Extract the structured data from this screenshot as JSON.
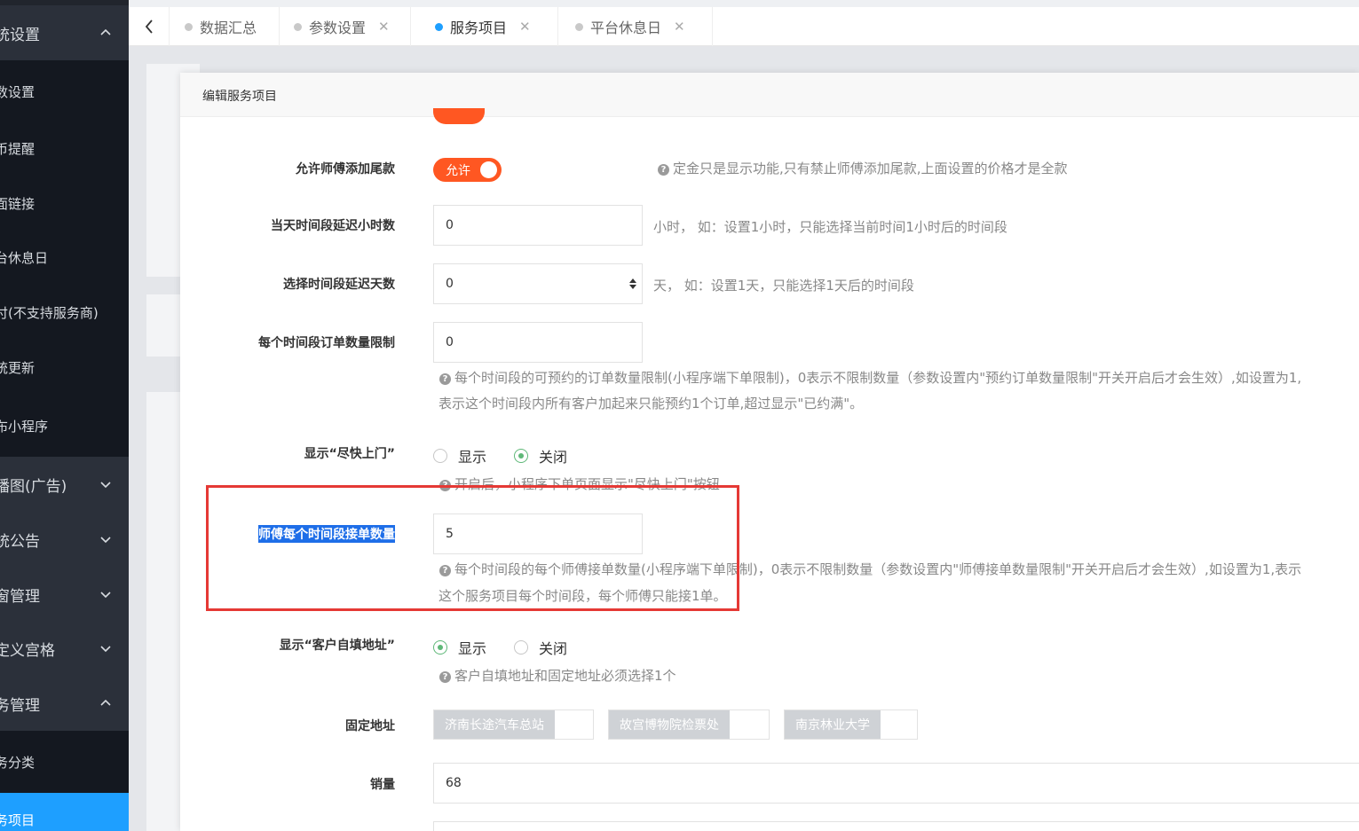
{
  "sidebar": {
    "items": [
      {
        "label": "统设置",
        "type": "group",
        "expanded": true
      },
      {
        "label": "数设置",
        "type": "sub"
      },
      {
        "label": "币提醒",
        "type": "sub"
      },
      {
        "label": "面链接",
        "type": "sub"
      },
      {
        "label": "台休息日",
        "type": "sub"
      },
      {
        "label": "付(不支持服务商)",
        "type": "sub"
      },
      {
        "label": "统更新",
        "type": "sub"
      },
      {
        "label": "布小程序",
        "type": "sub"
      },
      {
        "label": "播图(广告)",
        "type": "group",
        "expanded": false
      },
      {
        "label": "统公告",
        "type": "group",
        "expanded": false
      },
      {
        "label": "窗管理",
        "type": "group",
        "expanded": false
      },
      {
        "label": "定义宫格",
        "type": "group",
        "expanded": false
      },
      {
        "label": "务管理",
        "type": "group",
        "expanded": true
      },
      {
        "label": "务分类",
        "type": "sub"
      },
      {
        "label": "务项目",
        "type": "sub",
        "active": true
      }
    ]
  },
  "tabs": [
    {
      "label": "数据汇总",
      "closable": false,
      "active": false
    },
    {
      "label": "参数设置",
      "closable": true,
      "active": false
    },
    {
      "label": "服务项目",
      "closable": true,
      "active": true
    },
    {
      "label": "平台休息日",
      "closable": true,
      "active": false
    }
  ],
  "dialog": {
    "title": "编辑服务项目",
    "fields": {
      "allow_tail": {
        "label": "允许师傅添加尾款",
        "switch_text": "允许",
        "hint": "定金只是显示功能,只有禁止师傅添加尾款,上面设置的价格才是全款"
      },
      "delay_hours": {
        "label": "当天时间段延迟小时数",
        "value": "0",
        "hint": "小时，   如：设置1小时，只能选择当前时间1小时后的时间段"
      },
      "delay_days": {
        "label": "选择时间段延迟天数",
        "value": "0",
        "hint": "天，   如：设置1天，只能选择1天后的时间段"
      },
      "order_limit": {
        "label": "每个时间段订单数量限制",
        "value": "0",
        "hint_line1": "每个时间段的可预约的订单数量限制(小程序端下单限制)，0表示不限制数量（参数设置内\"预约订单数量限制\"开关开启后才会生效）,如设置为1,",
        "hint_line2": "表示这个时间段内所有客户加起来只能预约1个订单,超过显示\"已约满\"。"
      },
      "show_asap": {
        "label": "显示“尽快上门”",
        "option_show": "显示",
        "option_close": "关闭",
        "selected": "关闭",
        "hint": "开启后，小程序下单页面显示\"尽快上门\"按钮"
      },
      "worker_limit": {
        "label": "师傅每个时间段接单数量",
        "value": "5",
        "hint_line1": "每个时间段的每个师傅接单数量(小程序端下单限制)，0表示不限制数量（参数设置内\"师傅接单数量限制\"开关开启后才会生效）,如设置为1,表示",
        "hint_line2": "这个服务项目每个时间段，每个师傅只能接1单。"
      },
      "show_address": {
        "label": "显示“客户自填地址”",
        "option_show": "显示",
        "option_close": "关闭",
        "selected": "显示",
        "hint": "客户自填地址和固定地址必须选择1个"
      },
      "fixed_address": {
        "label": "固定地址",
        "tags": [
          "济南长途汽车总站",
          "故宫博物院检票处",
          "南京林业大学"
        ]
      },
      "sales": {
        "label": "销量",
        "value": "68"
      }
    }
  },
  "colors": {
    "sidebar_bg": "#21252d",
    "active_blue": "#1e9fff",
    "switch_orange": "#ff5722",
    "radio_green": "#5fb878",
    "highlight_red": "#e53935"
  }
}
